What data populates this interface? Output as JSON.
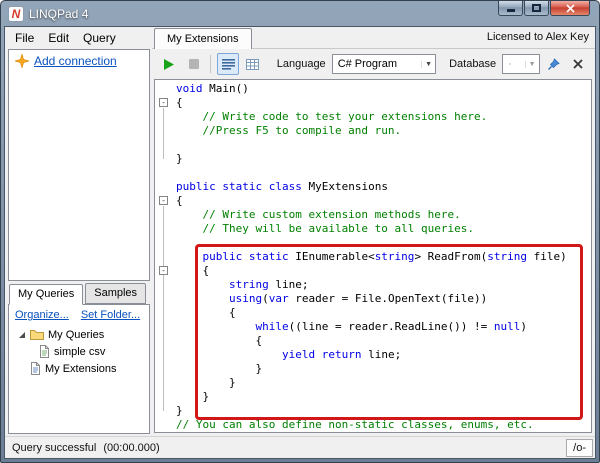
{
  "window": {
    "title": "LINQPad 4",
    "logo_glyph": "N"
  },
  "menu": {
    "items": [
      "File",
      "Edit",
      "Query"
    ]
  },
  "connections": {
    "add_link": "Add connection"
  },
  "left_tabs": {
    "my_queries": "My Queries",
    "samples": "Samples"
  },
  "left_links": {
    "organize": "Organize...",
    "set_folder": "Set Folder..."
  },
  "tree": {
    "items": [
      {
        "label": "My Queries",
        "icon": "folder-icon"
      },
      {
        "label": "simple csv",
        "icon": "query-file-icon"
      },
      {
        "label": "My Extensions",
        "icon": "extensions-file-icon"
      }
    ]
  },
  "header": {
    "tab_label": "My Extensions",
    "license": "Licensed to Alex Key"
  },
  "toolbar": {
    "language_label": "Language",
    "language_value": "C# Program",
    "database_label": "Database",
    "database_value": "·"
  },
  "icons": {
    "linqpad-logo": "N",
    "minimize": "bar-shape",
    "maximize": "square-outline",
    "close": "x-shape",
    "run": "green-play-triangle",
    "stop": "gray-square",
    "rich-text-results": "text-lines",
    "data-grid-results": "grid",
    "dropdown-arrow": "▼",
    "pin": "blue-pushpin",
    "close-query": "x-shape",
    "add-connection": "orange-sparkle-star",
    "expander": "expanded-triangle",
    "folder": "yellow-folder",
    "query-file": "page",
    "extensions-file": "page",
    "fold-toggle": "-"
  },
  "editor": {
    "lines": [
      [
        [
          "k",
          "void"
        ],
        [
          "p",
          " Main()"
        ]
      ],
      [
        [
          "p",
          "{"
        ]
      ],
      [
        [
          "c",
          "    // Write code to test your extensions here."
        ]
      ],
      [
        [
          "c",
          "    //Press F5 to compile and run."
        ]
      ],
      [],
      [
        [
          "p",
          "}"
        ]
      ],
      [],
      [
        [
          "k",
          "public static class"
        ],
        [
          "p",
          " MyExtensions"
        ]
      ],
      [
        [
          "p",
          "{"
        ]
      ],
      [
        [
          "c",
          "    // Write custom extension methods here."
        ]
      ],
      [
        [
          "c",
          "    // They will be available to all queries."
        ]
      ],
      [],
      [
        [
          "p",
          "    "
        ],
        [
          "k",
          "public static"
        ],
        [
          "p",
          " IEnumerable<"
        ],
        [
          "k",
          "string"
        ],
        [
          "p",
          "> ReadFrom("
        ],
        [
          "k",
          "string"
        ],
        [
          "p",
          " file)"
        ]
      ],
      [
        [
          "p",
          "    {"
        ]
      ],
      [
        [
          "p",
          "        "
        ],
        [
          "k",
          "string"
        ],
        [
          "p",
          " line;"
        ]
      ],
      [
        [
          "p",
          "        "
        ],
        [
          "k",
          "using"
        ],
        [
          "p",
          "("
        ],
        [
          "k",
          "var"
        ],
        [
          "p",
          " reader = File.OpenText(file))"
        ]
      ],
      [
        [
          "p",
          "        {"
        ]
      ],
      [
        [
          "p",
          "            "
        ],
        [
          "k",
          "while"
        ],
        [
          "p",
          "((line = reader.ReadLine()) != "
        ],
        [
          "k",
          "null"
        ],
        [
          "p",
          ")"
        ]
      ],
      [
        [
          "p",
          "            {"
        ]
      ],
      [
        [
          "p",
          "                "
        ],
        [
          "k",
          "yield return"
        ],
        [
          "p",
          " line;"
        ]
      ],
      [
        [
          "p",
          "            }"
        ]
      ],
      [
        [
          "p",
          "        }"
        ]
      ],
      [
        [
          "p",
          "    }"
        ]
      ],
      [
        [
          "p",
          "}"
        ]
      ],
      [
        [
          "c",
          "// You can also define non-static classes, enums, etc."
        ]
      ]
    ],
    "folds": [
      {
        "line": 1,
        "to": 5
      },
      {
        "line": 8,
        "to": 23
      },
      {
        "line": 13,
        "to": 22
      }
    ]
  },
  "annotation": {
    "color": "#d11717"
  },
  "status": {
    "message": "Query successful",
    "time": "(00:00.000)",
    "right_button": "/o-"
  }
}
